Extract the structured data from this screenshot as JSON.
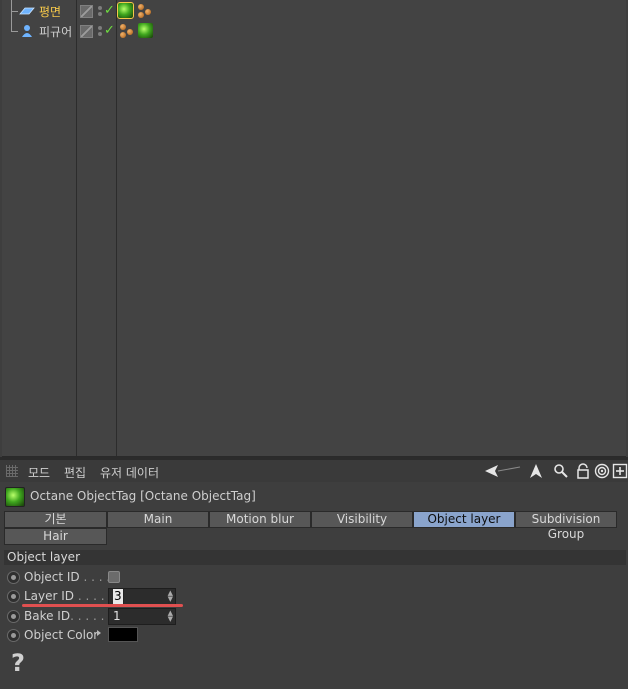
{
  "object_manager": {
    "rows": [
      {
        "name": "평면",
        "selected": true,
        "icon": "plane-object-icon"
      },
      {
        "name": "피규어",
        "selected": false,
        "icon": "figure-object-icon"
      }
    ]
  },
  "attr_manager": {
    "menu": [
      "모드",
      "편집",
      "유저 데이터"
    ],
    "toolbar_icons": [
      "back-arrow-icon",
      "pointer-arrow-icon",
      "search-icon",
      "lock-icon",
      "target-icon",
      "new-panel-icon"
    ],
    "title": "Octane ObjectTag [Octane ObjectTag]",
    "tabs": [
      {
        "label": "기본",
        "active": false
      },
      {
        "label": "Main",
        "active": false
      },
      {
        "label": "Motion blur",
        "active": false
      },
      {
        "label": "Visibility",
        "active": false
      },
      {
        "label": "Object layer",
        "active": true
      },
      {
        "label": "Subdivision Group",
        "active": false
      },
      {
        "label": "Hair",
        "active": false
      }
    ],
    "section_title": "Object layer",
    "properties": {
      "object_id": {
        "label": "Object ID",
        "dots": " . . . . ."
      },
      "layer_id": {
        "label": "Layer ID",
        "dots": " . . . . . .",
        "value": "3"
      },
      "bake_id": {
        "label": "Bake ID",
        "dots": ". . . . . . .",
        "value": "1"
      },
      "object_color": {
        "label": "Object Color",
        "color": "#000000"
      }
    },
    "help_glyph": "?"
  },
  "colors": {
    "accent_tab": "#8aa4cc",
    "selected_object": "#f5c84a",
    "highlight_underline": "#e05050"
  }
}
